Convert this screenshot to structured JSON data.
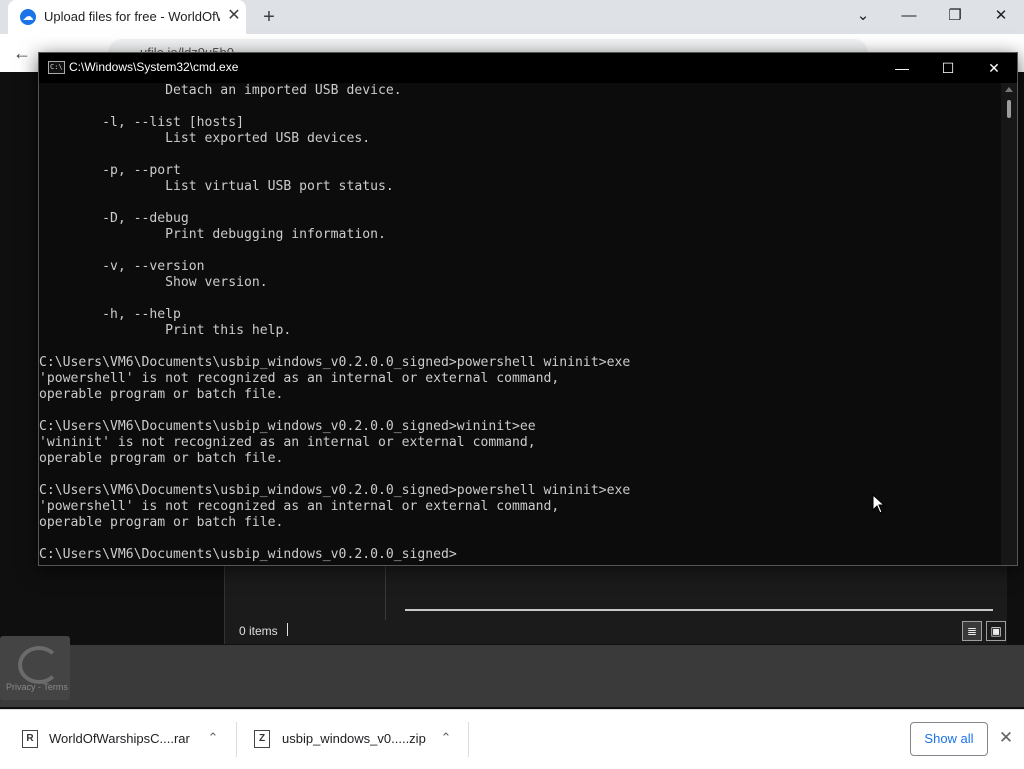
{
  "browser": {
    "tab_title": "Upload files for free - WorldOfW",
    "tab_close": "✕",
    "new_tab": "+",
    "controls": {
      "tablist": "⌄",
      "minimize": "—",
      "maximize": "❐",
      "close": "✕"
    },
    "back": "←",
    "forward": "→",
    "url": "ufile.io/ldz9u5b0"
  },
  "cmd": {
    "title": "C:\\Windows\\System32\\cmd.exe",
    "controls": {
      "minimize": "—",
      "maximize": "☐",
      "close": "✕"
    },
    "lines": [
      "                Detach an imported USB device.",
      "",
      "        -l, --list [hosts]",
      "                List exported USB devices.",
      "",
      "        -p, --port",
      "                List virtual USB port status.",
      "",
      "        -D, --debug",
      "                Print debugging information.",
      "",
      "        -v, --version",
      "                Show version.",
      "",
      "        -h, --help",
      "                Print this help.",
      "",
      "C:\\Users\\VM6\\Documents\\usbip_windows_v0.2.0.0_signed>powershell wininit>exe",
      "'powershell' is not recognized as an internal or external command,",
      "operable program or batch file.",
      "",
      "C:\\Users\\VM6\\Documents\\usbip_windows_v0.2.0.0_signed>wininit>ee",
      "'wininit' is not recognized as an internal or external command,",
      "operable program or batch file.",
      "",
      "C:\\Users\\VM6\\Documents\\usbip_windows_v0.2.0.0_signed>powershell wininit>exe",
      "'powershell' is not recognized as an internal or external command,",
      "operable program or batch file.",
      "",
      "C:\\Users\\VM6\\Documents\\usbip_windows_v0.2.0.0_signed>"
    ]
  },
  "explorer": {
    "items_count": "0 items",
    "view_details_icon": "≣",
    "view_tiles_icon": "▣"
  },
  "recaptcha": {
    "text": "Privacy - Terms"
  },
  "downloads": {
    "items": [
      {
        "name": "WorldOfWarshipsC....rar",
        "icon": "R",
        "chevron": "⌃"
      },
      {
        "name": "usbip_windows_v0.....zip",
        "icon": "Z",
        "chevron": "⌃"
      }
    ],
    "show_all": "Show all",
    "close": "✕"
  }
}
